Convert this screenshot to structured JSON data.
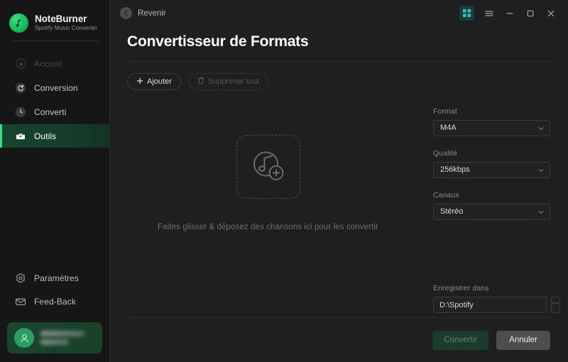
{
  "sidebar": {
    "brand": {
      "title": "NoteBurner",
      "subtitle": "Spotify Music Converter",
      "logo_icon": "music-note-circle-icon"
    },
    "items": [
      {
        "label": "Accueil",
        "icon": "home-icon",
        "state": "dim"
      },
      {
        "label": "Conversion",
        "icon": "sync-icon",
        "state": "normal"
      },
      {
        "label": "Converti",
        "icon": "clock-icon",
        "state": "normal"
      },
      {
        "label": "Outils",
        "icon": "toolbox-icon",
        "state": "active"
      }
    ],
    "bottom_items": [
      {
        "label": "Paramètres",
        "icon": "settings-icon"
      },
      {
        "label": "Feed-Back",
        "icon": "envelope-icon"
      }
    ],
    "user": {
      "name": "",
      "plan": "",
      "avatar_icon": "user-icon",
      "redacted": true
    }
  },
  "titlebar": {
    "back_label": "Revenir",
    "back_icon": "back-arrow-circle-icon",
    "grid_icon": "grid-view-icon",
    "menu_icon": "hamburger-menu-icon",
    "minimize_icon": "minimize-icon",
    "maximize_icon": "maximize-icon",
    "close_icon": "close-icon"
  },
  "page": {
    "title": "Convertisseur de Formats"
  },
  "toolbar": {
    "add_label": "Ajouter",
    "add_icon": "plus-icon",
    "delete_all_label": "Supprimer tout",
    "delete_all_icon": "trash-icon",
    "delete_all_disabled": true
  },
  "dropzone": {
    "icon": "add-music-note-icon",
    "hint": "Faites glisser & déposez des chansons ici pour les convertir"
  },
  "settings": {
    "format": {
      "label": "Format",
      "value": "M4A"
    },
    "quality": {
      "label": "Qualité",
      "value": "256kbps"
    },
    "channels": {
      "label": "Canaux",
      "value": "Stéréo"
    },
    "output": {
      "label": "Enregistrer dans",
      "value": "D:\\Spotify",
      "placeholder": "D:\\Spotify",
      "browse_label": "···"
    }
  },
  "footer": {
    "convert_label": "Convertir",
    "convert_disabled": true,
    "cancel_label": "Annuler"
  },
  "colors": {
    "accent_green": "#2fe07e",
    "brand_green": "#18b85c",
    "teal_active": "#2ec4c4",
    "window_bg": "#1f1f1f",
    "sidebar_bg": "#161616"
  }
}
